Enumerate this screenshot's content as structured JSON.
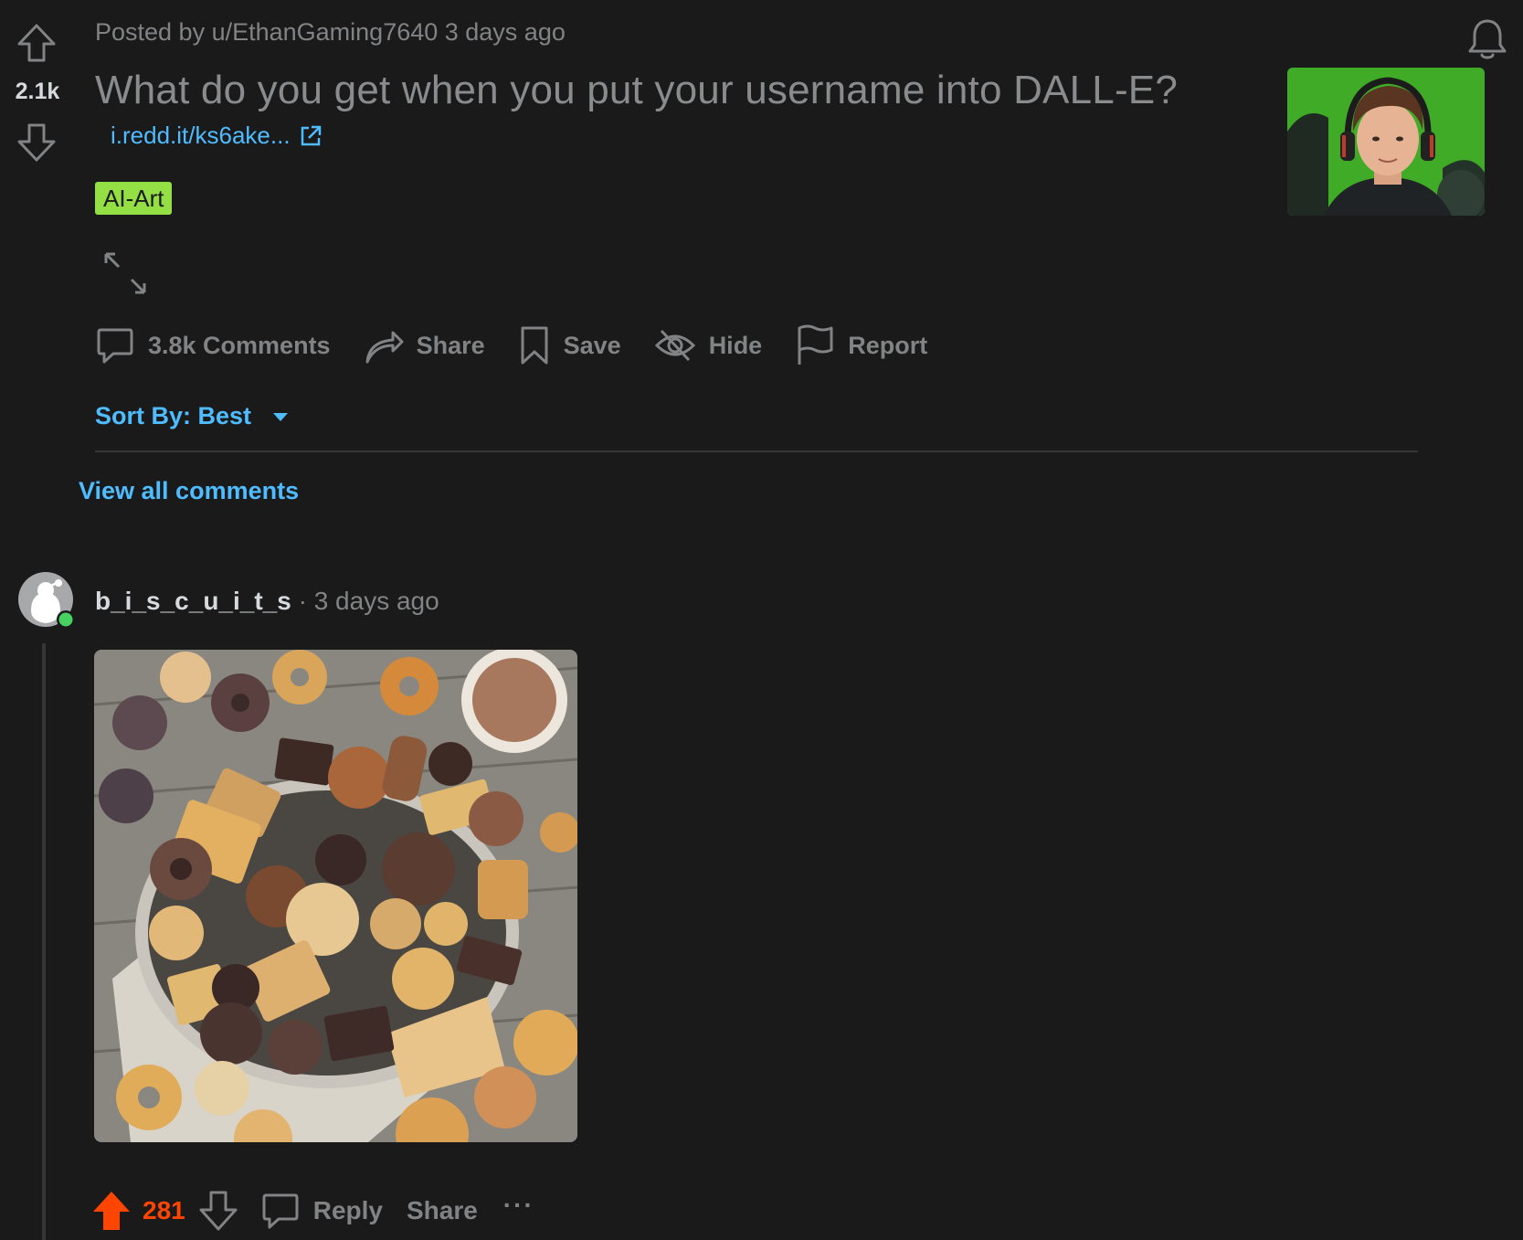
{
  "post": {
    "score": "2.1k",
    "meta": "Posted by u/EthanGaming7640 3 days ago",
    "title": "What do you get when you put your username into DALL-E?",
    "link_text": "i.redd.it/ks6ake...",
    "flair": "AI-Art",
    "flair_color": "#94e044",
    "thumbnail_bg": "#43b02a"
  },
  "actions": {
    "comments": "3.8k Comments",
    "share": "Share",
    "save": "Save",
    "hide": "Hide",
    "report": "Report"
  },
  "sort": {
    "label": "Sort By: Best"
  },
  "view_all": "View all comments",
  "comment": {
    "username": "b_i_s_c_u_i_t_s",
    "separator": " · ",
    "time": "3 days ago",
    "score": "281",
    "reply": "Reply",
    "share": "Share",
    "more": "···"
  },
  "colors": {
    "background": "#1a1a1b",
    "accent_blue": "#4fbcff",
    "upvote_orange": "#ff4500",
    "muted": "#818384",
    "online": "#46d160"
  },
  "icons": {
    "upvote": "arrow-up-icon",
    "downvote": "arrow-down-icon",
    "notify": "bell-icon",
    "external": "external-link-icon",
    "expand": "expand-icon",
    "comments": "comment-bubble-icon",
    "share": "share-arrow-icon",
    "save": "bookmark-icon",
    "hide": "eye-slash-icon",
    "report": "flag-icon",
    "sort": "caret-down-icon"
  }
}
